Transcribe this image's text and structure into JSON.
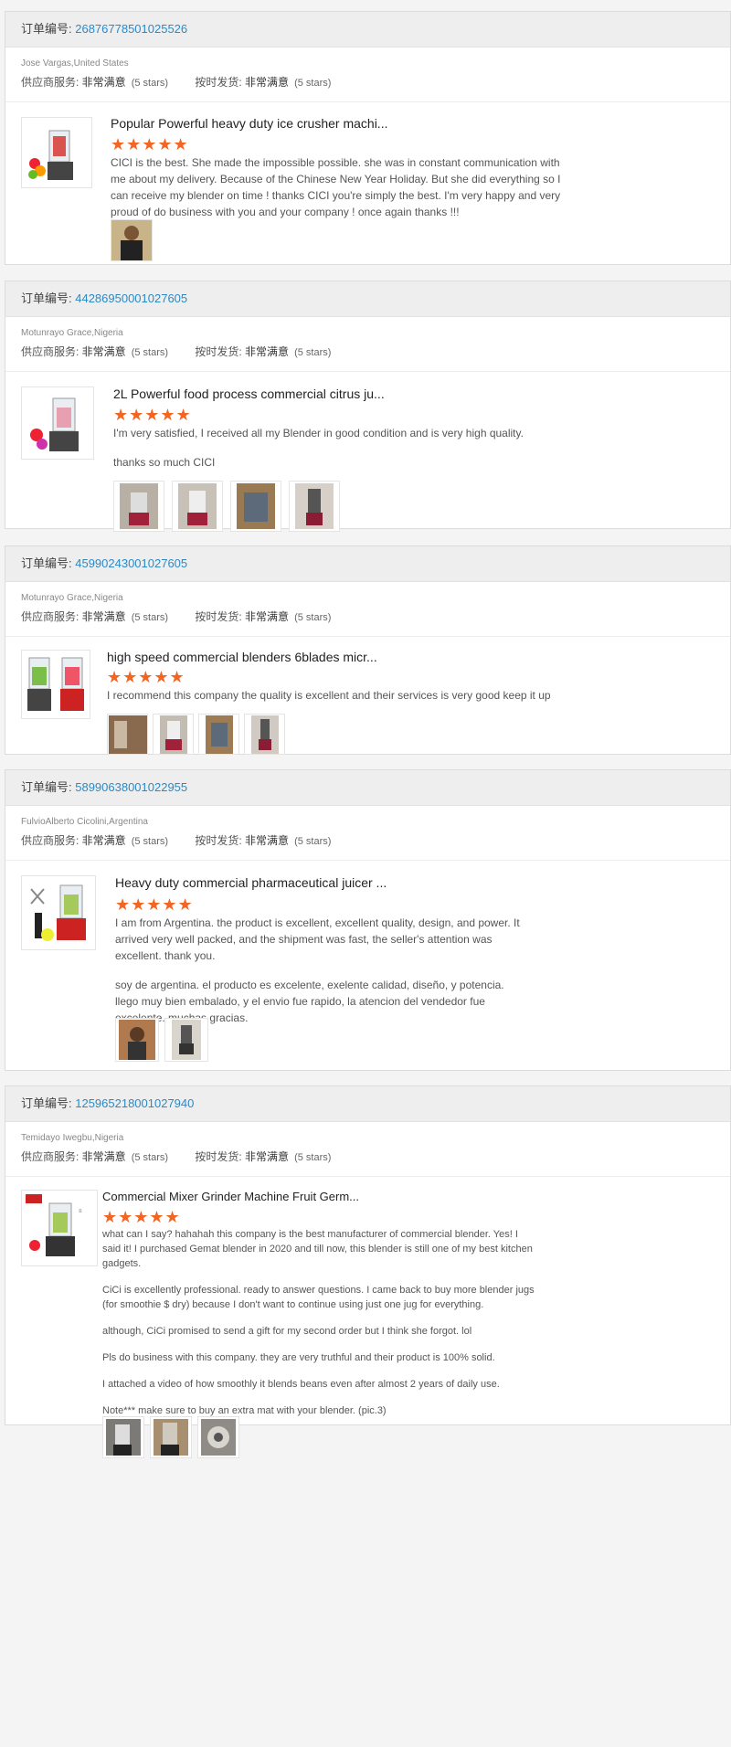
{
  "labels": {
    "order_prefix": "订单编号: ",
    "service": "供应商服务: ",
    "shipping": "按时发货: ",
    "satisfaction": "非常满意",
    "stars_text": "(5 stars)"
  },
  "star_icons": "★★★★★",
  "reviews": [
    {
      "order_no": "26876778501025526",
      "buyer": "Jose Vargas,United States",
      "title": "Popular Powerful heavy duty ice crusher machi...",
      "rating": 5,
      "paragraphs": [
        "CICI is the best. She made the impossible possible. she was in constant communication with me about my delivery. Because of the Chinese New Year Holiday. But she did everything so I can receive my blender on time ! thanks CICI you're simply the best. I'm very happy and very proud of do business with you and your company ! once again thanks !!!"
      ],
      "photo_count": 1
    },
    {
      "order_no": "44286950001027605",
      "buyer": "Motunrayo Grace,Nigeria",
      "title": "2L Powerful food process commercial citrus ju...",
      "rating": 5,
      "paragraphs": [
        "I'm very satisfied, I received all my Blender in good condition and is very high quality.",
        "thanks so much CICI"
      ],
      "photo_count": 4
    },
    {
      "order_no": "45990243001027605",
      "buyer": "Motunrayo Grace,Nigeria",
      "title": "high speed commercial blenders 6blades micr...",
      "rating": 5,
      "paragraphs": [
        "I recommend this company the quality is excellent and their services is very good keep it up"
      ],
      "photo_count": 4
    },
    {
      "order_no": "58990638001022955",
      "buyer": "FulvioAlberto Cicolini,Argentina",
      "title": "Heavy duty commercial pharmaceutical juicer ...",
      "rating": 5,
      "paragraphs": [
        "I am from Argentina. the product is excellent, excellent quality, design, and power. It arrived very well packed, and the shipment was fast, the seller's attention was excellent. thank you.",
        "soy de argentina. el producto es excelente, exelente calidad, diseño, y potencia. llego muy bien embalado, y el envio fue rapido, la atencion del vendedor fue excelente. muchas gracias."
      ],
      "photo_count": 2
    },
    {
      "order_no": "125965218001027940",
      "buyer": "Temidayo Iwegbu,Nigeria",
      "title": "Commercial Mixer Grinder Machine Fruit Germ...",
      "rating": 5,
      "paragraphs": [
        "what can I say? hahahah this company is the best manufacturer of commercial blender. Yes! I said it! I purchased Gemat blender in 2020 and till now, this blender is still one of my best kitchen gadgets.",
        "CiCi is excellently professional. ready to answer questions. I came back to buy more blender jugs (for smoothie $ dry) because I don't want to continue using just one jug for everything.",
        "although, CiCi promised to send a gift for my second order but I think she forgot. lol",
        "Pls  do business with this company. they are very truthful and their product is 100% solid.",
        "I attached a video of how smoothly it blends beans even after almost 2 years of daily use.",
        "Note*** make sure to buy an extra mat with your blender. (pic.3)"
      ],
      "photo_count": 3
    }
  ]
}
